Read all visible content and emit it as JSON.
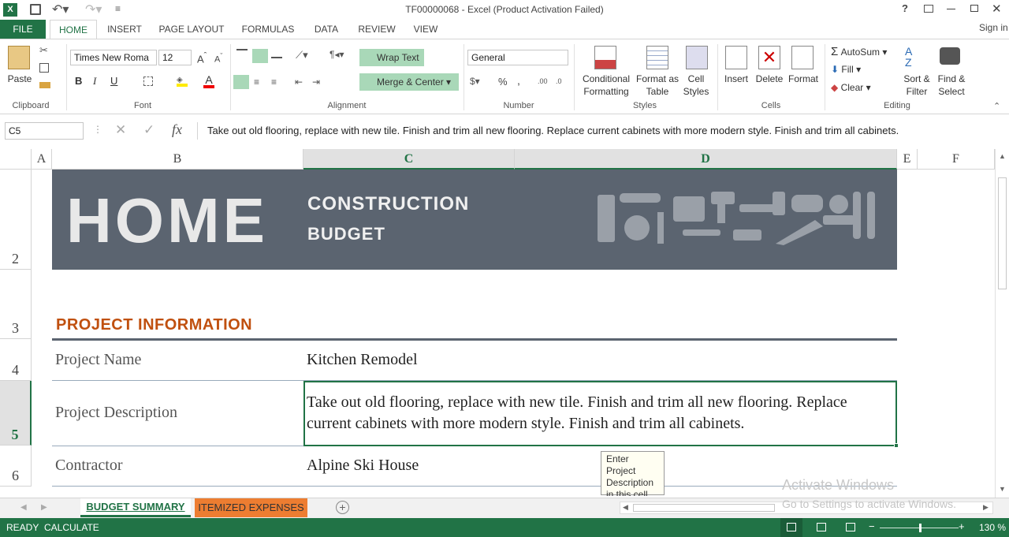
{
  "window": {
    "title": "TF00000068 - Excel (Product Activation Failed)",
    "sign_in": "Sign in"
  },
  "tabs": [
    "FILE",
    "HOME",
    "INSERT",
    "PAGE LAYOUT",
    "FORMULAS",
    "DATA",
    "REVIEW",
    "VIEW"
  ],
  "ribbon": {
    "clipboard": {
      "paste": "Paste",
      "label": "Clipboard"
    },
    "font": {
      "name": "Times New Roma",
      "size": "12",
      "label": "Font",
      "bold": "B",
      "italic": "I",
      "underline": "U"
    },
    "alignment": {
      "wrap": "Wrap Text",
      "merge": "Merge & Center",
      "label": "Alignment"
    },
    "number": {
      "format": "General",
      "label": "Number",
      "percent": "%"
    },
    "styles": {
      "cond1": "Conditional",
      "cond2": "Formatting",
      "fmt1": "Format as",
      "fmt2": "Table",
      "cell1": "Cell",
      "cell2": "Styles",
      "label": "Styles"
    },
    "cells": {
      "insert": "Insert",
      "delete": "Delete",
      "format": "Format",
      "label": "Cells"
    },
    "editing": {
      "autosum": "AutoSum",
      "fill": "Fill",
      "clear": "Clear",
      "sort1": "Sort &",
      "sort2": "Filter",
      "find1": "Find &",
      "find2": "Select",
      "label": "Editing"
    }
  },
  "formula_bar": {
    "name_box": "C5",
    "fx": "fx",
    "content": "Take out old flooring, replace with new tile.  Finish and trim all new flooring.  Replace current cabinets with more modern style.  Finish and trim all cabinets."
  },
  "columns": [
    "A",
    "B",
    "C",
    "D",
    "E",
    "F"
  ],
  "rows": [
    "2",
    "3",
    "4",
    "5",
    "6"
  ],
  "banner": {
    "home": "HOME",
    "line1": "CONSTRUCTION",
    "line2": "BUDGET"
  },
  "section_title": "PROJECT INFORMATION",
  "fields": [
    {
      "label": "Project Name",
      "value": "Kitchen Remodel"
    },
    {
      "label": "Project Description",
      "value_line1": "Take out old flooring, replace with new tile.  Finish and trim all new flooring.  Replace",
      "value_line2": "current cabinets with more modern style.  Finish and trim all cabinets."
    },
    {
      "label": "Contractor",
      "value": "Alpine Ski House"
    }
  ],
  "tooltip": {
    "l1": "Enter Project",
    "l2": "Description",
    "l3": "in this cell"
  },
  "watermark": {
    "l1": "Activate Windows",
    "l2": "Go to Settings to activate Windows."
  },
  "sheets": [
    "BUDGET SUMMARY",
    "ITEMIZED EXPENSES"
  ],
  "status": {
    "ready": "READY",
    "calculate": "CALCULATE",
    "zoom": "130 %"
  },
  "colors": {
    "excel_green": "#217346",
    "banner": "#5b6470",
    "accent": "#c0500f",
    "tab_orange": "#ed7d31"
  }
}
